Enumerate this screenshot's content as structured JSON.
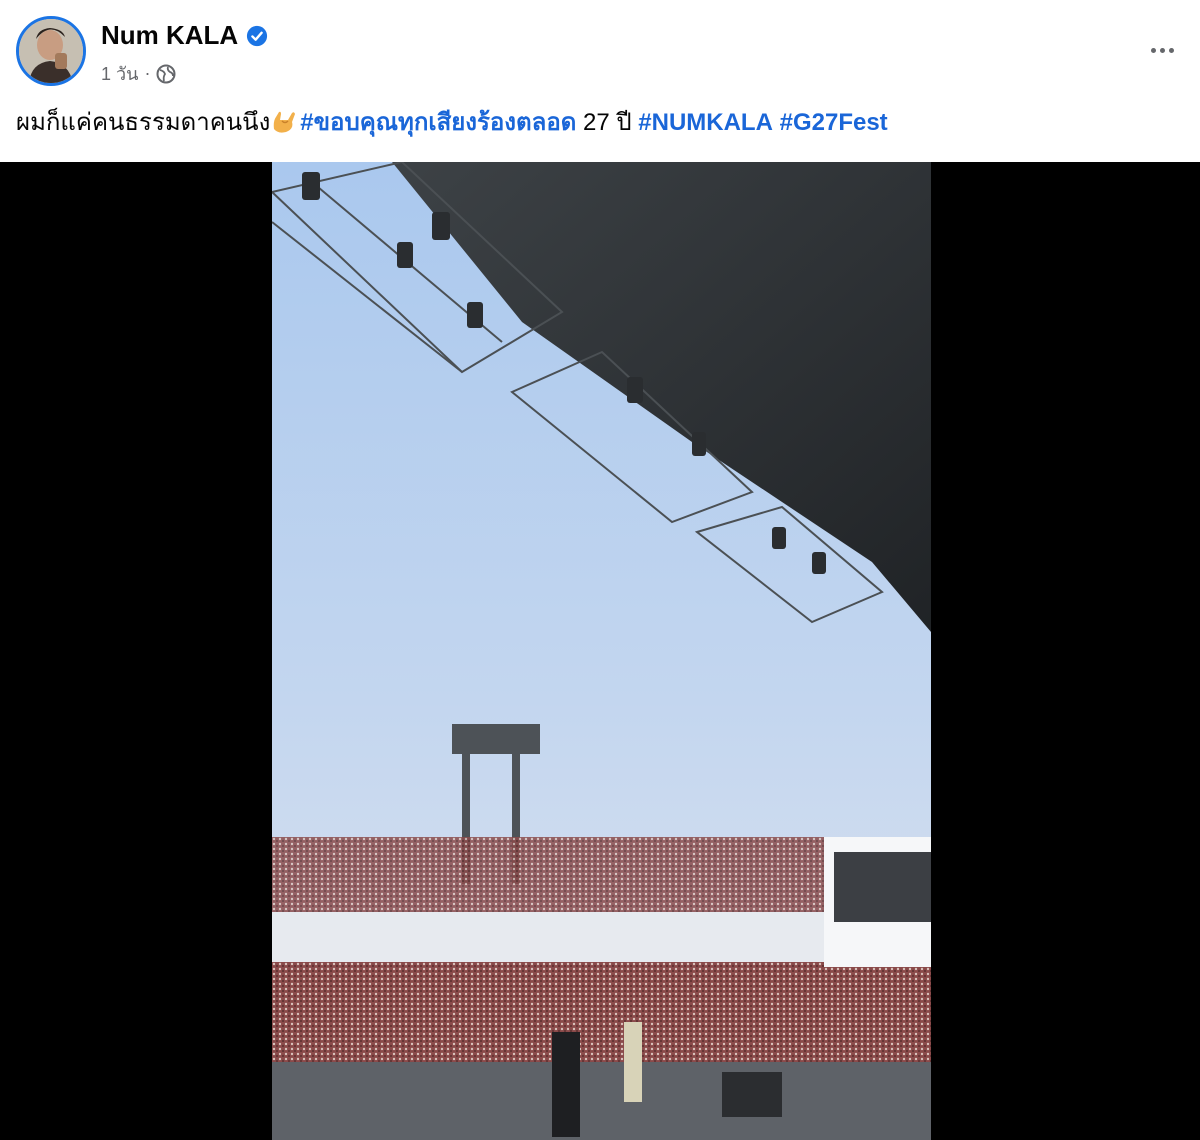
{
  "post": {
    "author": "Num KALA",
    "verified_icon": "verified-badge-icon",
    "time": "1 วัน",
    "separator": "·",
    "audience_icon": "globe-icon",
    "more_icon": "more-options-icon",
    "caption": {
      "text": "ผมก็แค่คนธรรมดาคนนึง",
      "emoji": "🤟",
      "hashtag1": "#ขอบคุณทุกเสียงร้องตลอด",
      "plain": " 27 ปี ",
      "hashtag2": "#NUMKALA",
      "hashtag3": "#G27Fest"
    }
  },
  "media": {
    "type": "video",
    "subject": "stadium-concert"
  },
  "colors": {
    "link": "#1a66d8",
    "verified": "#1b74e4",
    "secondary_text": "#65676b",
    "media_background": "#000000"
  }
}
